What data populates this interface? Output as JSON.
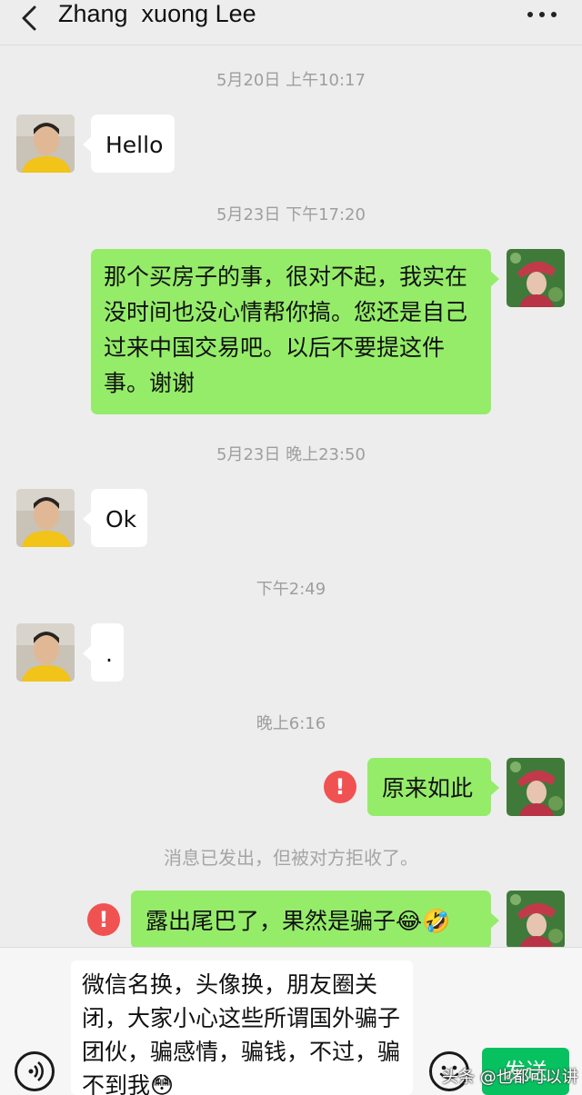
{
  "header": {
    "title": "Zhang  xuong Lee",
    "back_icon": "chevron-left-icon",
    "more_icon": "more-dots-icon"
  },
  "messages": {
    "ts1": "5月20日 上午10:17",
    "m1": "Hello",
    "ts2": "5月23日 下午17:20",
    "m2": "那个买房子的事，很对不起，我实在没时间也没心情帮你搞。您还是自己过来中国交易吧。以后不要提这件事。谢谢",
    "ts3": "5月23日 晚上23:50",
    "m3": "Ok",
    "ts4": "下午2:49",
    "m4": ".",
    "ts5": "晚上6:16",
    "m5": "原来如此",
    "error_icon": "!",
    "rejected_note": "消息已发出，但被对方拒收了。",
    "m6": "露出尾巴了，果然是骗子😂🤣"
  },
  "input": {
    "draft": "微信名换，头像换，朋友圈关闭，大家小心这些所谓国外骗子团伙，骗感情，骗钱，不过，骗不到我😳",
    "send_label": "发送",
    "voice_icon": "voice-icon",
    "emoji_icon": "emoji-icon"
  },
  "watermark": "头条 @也都可以讲",
  "colors": {
    "outgoing_bubble": "#95ec69",
    "incoming_bubble": "#ffffff",
    "error": "#f05252",
    "send_button": "#07c160"
  }
}
